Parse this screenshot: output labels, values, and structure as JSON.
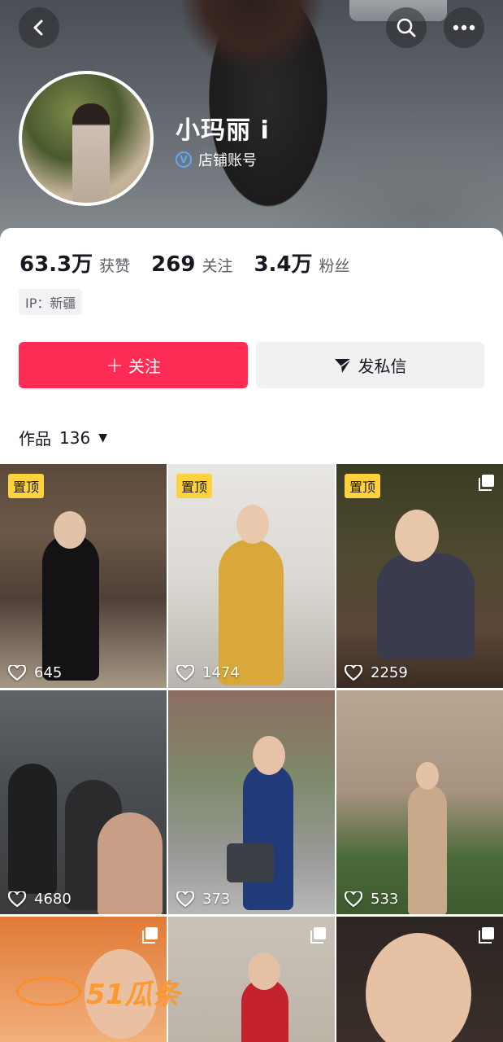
{
  "profile": {
    "name": "小玛丽 i",
    "badge_label": "店铺账号",
    "badge_icon": "verified-v-icon"
  },
  "stats": [
    {
      "value": "63.3万",
      "label": "获赞"
    },
    {
      "value": "269",
      "label": "关注"
    },
    {
      "value": "3.4万",
      "label": "粉丝"
    }
  ],
  "ip_location": "IP：新疆",
  "actions": {
    "follow_label": "关注",
    "follow_icon": "plus-icon",
    "message_label": "发私信",
    "message_icon": "send-icon"
  },
  "works_tab": {
    "label": "作品",
    "count": "136"
  },
  "header_icons": [
    "back-icon",
    "search-icon",
    "more-icon"
  ],
  "pin_label": "置顶",
  "videos": [
    {
      "likes": "645",
      "pinned": true,
      "multi": false
    },
    {
      "likes": "1474",
      "pinned": true,
      "multi": false
    },
    {
      "likes": "2259",
      "pinned": true,
      "multi": true
    },
    {
      "likes": "4680",
      "pinned": false,
      "multi": false
    },
    {
      "likes": "373",
      "pinned": false,
      "multi": false
    },
    {
      "likes": "533",
      "pinned": false,
      "multi": false
    },
    {
      "likes": "",
      "pinned": false,
      "multi": true
    },
    {
      "likes": "",
      "pinned": false,
      "multi": true
    },
    {
      "likes": "",
      "pinned": false,
      "multi": true
    }
  ],
  "watermark_text": "51瓜条",
  "colors": {
    "follow_button": "#fe2c55",
    "pin_badge": "#fdd23c",
    "message_button": "#f1f1f2"
  }
}
